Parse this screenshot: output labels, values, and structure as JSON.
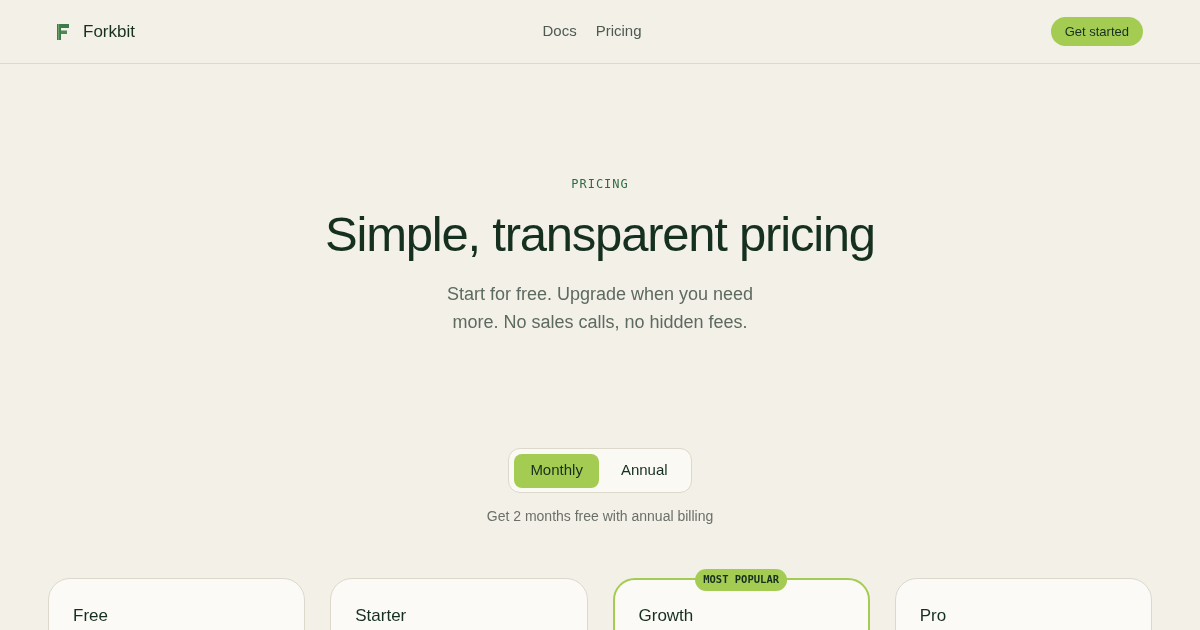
{
  "header": {
    "brand": "Forkbit",
    "nav": [
      {
        "label": "Docs"
      },
      {
        "label": "Pricing"
      }
    ],
    "cta": "Get started"
  },
  "hero": {
    "eyebrow": "PRICING",
    "title": "Simple, transparent pricing",
    "subtitle": "Start for free. Upgrade when you need more. No sales calls, no hidden fees."
  },
  "billing_toggle": {
    "options": [
      {
        "label": "Monthly",
        "selected": true
      },
      {
        "label": "Annual",
        "selected": false
      }
    ],
    "note": "Get 2 months free with annual billing"
  },
  "plans": [
    {
      "name": "Free",
      "featured": false
    },
    {
      "name": "Starter",
      "featured": false
    },
    {
      "name": "Growth",
      "featured": true,
      "badge": "MOST POPULAR"
    },
    {
      "name": "Pro",
      "featured": false
    }
  ]
}
